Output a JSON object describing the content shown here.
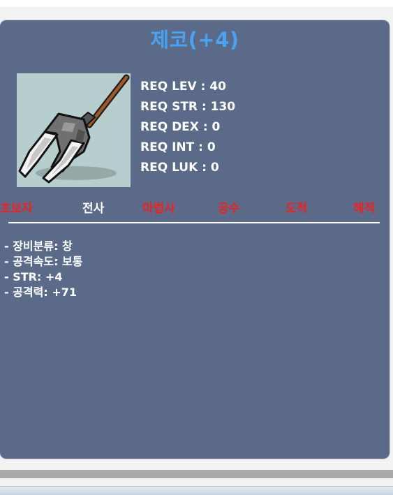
{
  "item": {
    "name": "제코(+4)",
    "icon": "polearm-weapon-icon",
    "title_color": "#4aa3f2"
  },
  "requirements": [
    {
      "label": "REQ LEV",
      "value": "40",
      "text": "REQ LEV : 40"
    },
    {
      "label": "REQ STR",
      "value": "130",
      "text": "REQ STR : 130"
    },
    {
      "label": "REQ DEX",
      "value": "0",
      "text": "REQ DEX : 0"
    },
    {
      "label": "REQ INT",
      "value": "0",
      "text": "REQ INT : 0"
    },
    {
      "label": "REQ LUK",
      "value": "0",
      "text": "REQ LUK : 0"
    }
  ],
  "jobs": [
    {
      "name": "초보자",
      "available": false
    },
    {
      "name": "전사",
      "available": true
    },
    {
      "name": "마법사",
      "available": false
    },
    {
      "name": "궁수",
      "available": false
    },
    {
      "name": "도적",
      "available": false
    },
    {
      "name": "해적",
      "available": false
    }
  ],
  "stats": [
    "- 장비분류: 창",
    "- 공격속도: 보통",
    "- STR: +4",
    "- 공격력: +71"
  ],
  "colors": {
    "panel": "#5b6a88",
    "job_available": "#ffffff",
    "job_unavailable": "#ee2222"
  }
}
